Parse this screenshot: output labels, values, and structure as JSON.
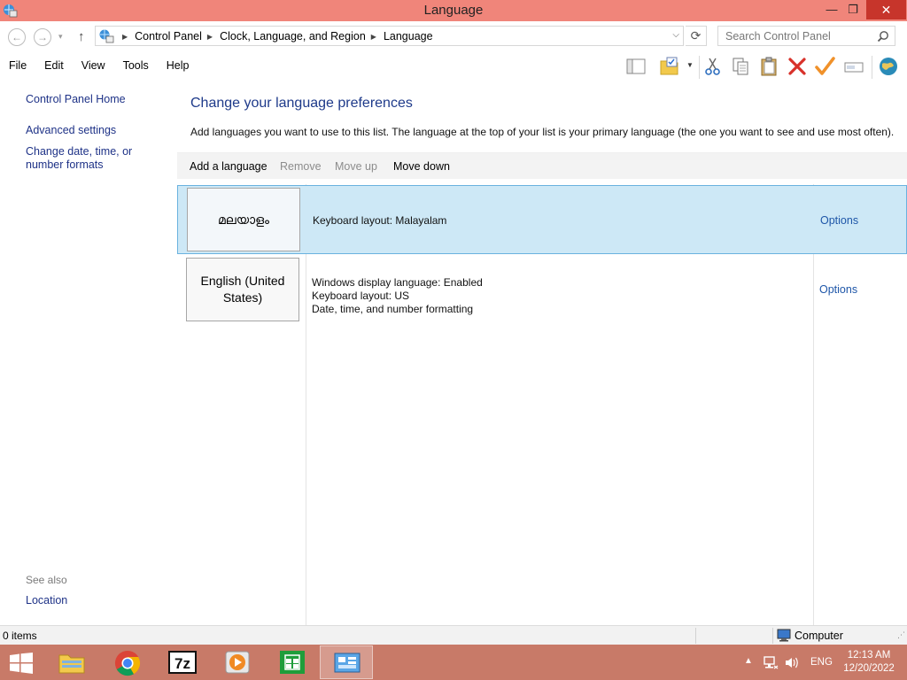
{
  "window": {
    "title": "Language",
    "minimize": "—",
    "maximize": "❐",
    "close": "✕"
  },
  "address": {
    "back": "←",
    "forward": "→",
    "recent": "▾",
    "up": "↑",
    "crumbs": [
      "Control Panel",
      "Clock, Language, and Region",
      "Language"
    ],
    "dropdown": "⌵",
    "refresh": "⟳",
    "search_placeholder": "Search Control Panel"
  },
  "menu": [
    "File",
    "Edit",
    "View",
    "Tools",
    "Help"
  ],
  "toolbar_icons": [
    "layout-icon",
    "properties-folder-icon",
    "cut-icon",
    "copy-icon",
    "paste-icon",
    "delete-icon",
    "check-icon",
    "rename-icon",
    "globe-icon"
  ],
  "sidebar": {
    "links": [
      "Control Panel Home",
      "Advanced settings",
      "Change date, time, or number formats"
    ],
    "see_also": "See also",
    "see_also_links": [
      "Location"
    ]
  },
  "main": {
    "heading": "Change your language preferences",
    "description": "Add languages you want to use to this list. The language at the top of your list is your primary language (the one you want to see and use most often).",
    "commands": {
      "add": "Add a language",
      "remove": "Remove",
      "move_up": "Move up",
      "move_down": "Move down"
    },
    "languages": [
      {
        "name": "മലയാളം",
        "details": [
          "Keyboard layout: Malayalam"
        ],
        "options": "Options",
        "selected": true
      },
      {
        "name": "English (United States)",
        "details": [
          "Windows display language: Enabled",
          "Keyboard layout: US",
          "Date, time, and number formatting"
        ],
        "options": "Options",
        "selected": false
      }
    ]
  },
  "status": {
    "items": "0 items",
    "computer": "Computer"
  },
  "taskbar": {
    "apps": [
      "windows-start",
      "file-explorer",
      "chrome",
      "7-zip",
      "media-player",
      "store",
      "control-panel"
    ],
    "tray_up": "▲",
    "lang": "ENG",
    "time": "12:13 AM",
    "date": "12/20/2022"
  },
  "colors": {
    "titlebar": "#f0857a",
    "taskbar": "#c87a68",
    "link": "#1e3287",
    "selection": "#cde8f6"
  }
}
